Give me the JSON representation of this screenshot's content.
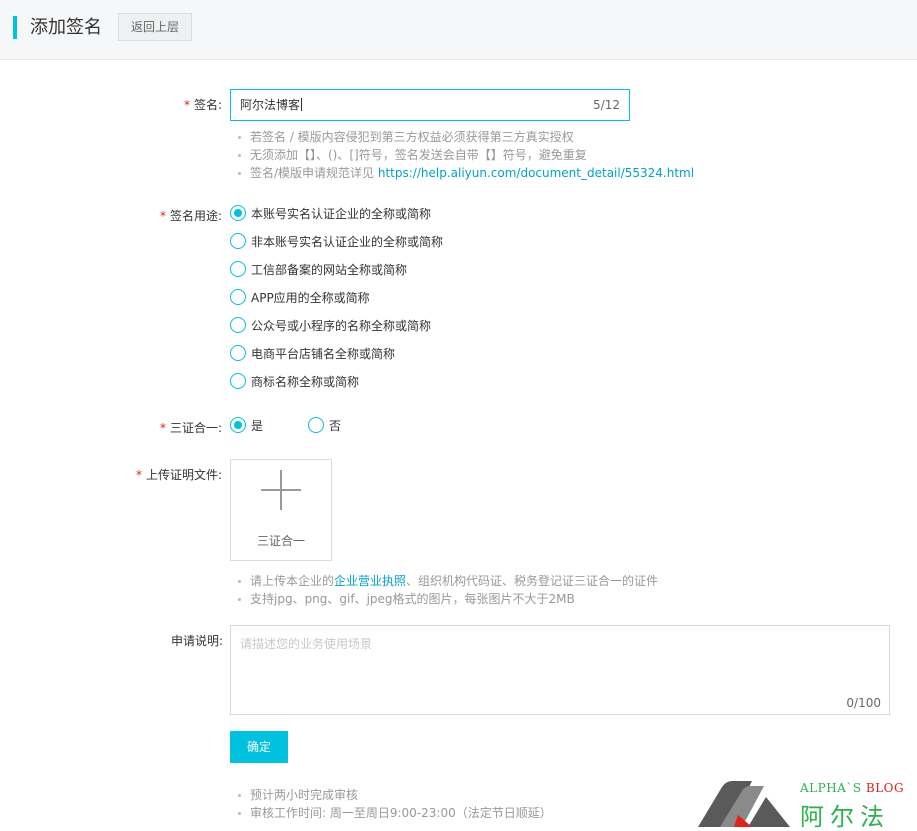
{
  "header": {
    "title": "添加签名",
    "back_label": "返回上层"
  },
  "signature": {
    "label": "签名:",
    "value": "阿尔法博客",
    "count": "5/12",
    "tips": [
      "若签名 / 模版内容侵犯到第三方权益必须获得第三方真实授权",
      "无须添加【】、()、[]符号，签名发送会自带【】符号，避免重复"
    ],
    "tip_link_prefix": "签名/模版申请规范详见 ",
    "tip_link": "https://help.aliyun.com/document_detail/55324.html"
  },
  "usage": {
    "label": "签名用途:",
    "options": [
      "本账号实名认证企业的全称或简称",
      "非本账号实名认证企业的全称或简称",
      "工信部备案的网站全称或简称",
      "APP应用的全称或简称",
      "公众号或小程序的名称全称或简称",
      "电商平台店铺名全称或简称",
      "商标名称全称或简称"
    ],
    "selected_index": 0
  },
  "three_in_one": {
    "label": "三证合一:",
    "yes": "是",
    "no": "否",
    "selected": "yes"
  },
  "upload": {
    "label": "上传证明文件:",
    "box_label": "三证合一",
    "tip1_prefix": "请上传本企业的",
    "tip1_link": "企业营业执照",
    "tip1_suffix": "、组织机构代码证、税务登记证三证合一的证件",
    "tip2": "支持jpg、png、gif、jpeg格式的图片，每张图片不大于2MB"
  },
  "description": {
    "label": "申请说明:",
    "placeholder": "请描述您的业务使用场景",
    "count": "0/100"
  },
  "confirm_label": "确定",
  "footer_tips": [
    "预计两小时完成审核",
    "审核工作时间: 周一至周日9:00-23:00（法定节日顺延）"
  ],
  "watermark": {
    "en": "ALPHA`S",
    "en_blog": "BLOG",
    "cn": "阿尔法"
  },
  "colors": {
    "accent": "#00c1de",
    "required": "#e2231a",
    "link": "#00a2ca",
    "logo_green": "#28b34b"
  }
}
